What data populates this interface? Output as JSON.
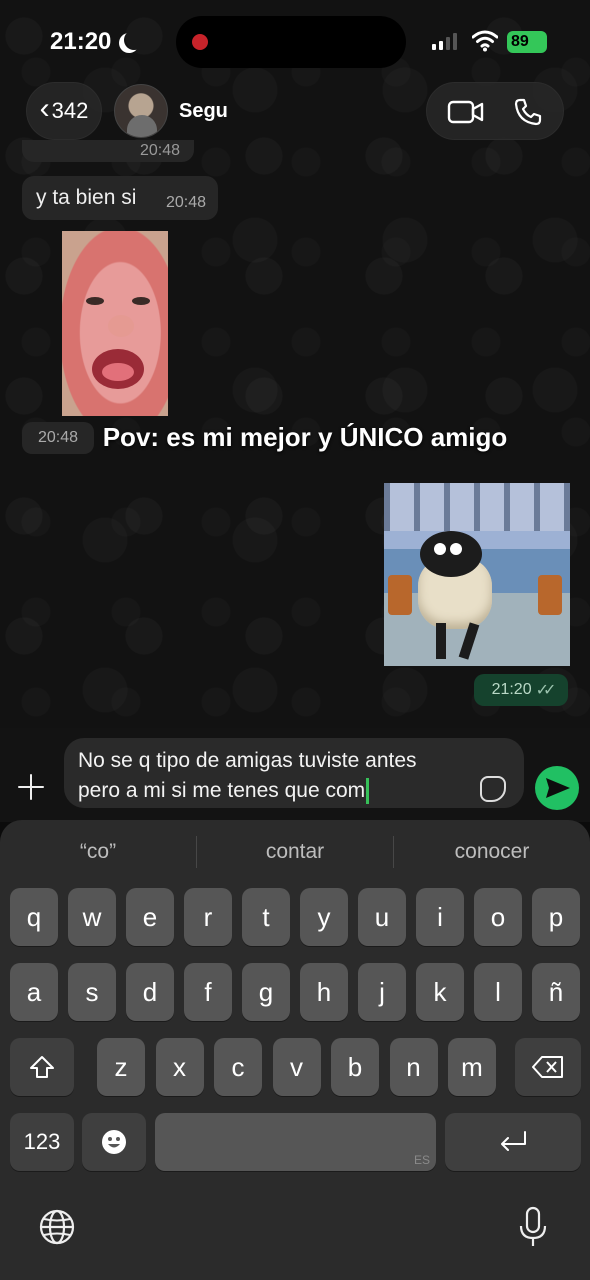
{
  "status_bar": {
    "time": "21:20",
    "battery": "89"
  },
  "header": {
    "back_count": "342",
    "contact_name": "Segu"
  },
  "messages": {
    "partial_time": "20:48",
    "text_message": "y ta bien si",
    "text_time": "20:48",
    "image_time": "20:48",
    "caption": "Pov: es mi mejor y ÚNICO amigo",
    "sent_time": "21:20"
  },
  "compose": {
    "line1": "No se q tipo de amigas tuviste antes",
    "line2": "pero a mi si me tenes que com"
  },
  "keyboard": {
    "suggestions": [
      "“co”",
      "contar",
      "conocer"
    ],
    "row1": [
      "q",
      "w",
      "e",
      "r",
      "t",
      "y",
      "u",
      "i",
      "o",
      "p"
    ],
    "row2": [
      "a",
      "s",
      "d",
      "f",
      "g",
      "h",
      "j",
      "k",
      "l",
      "ñ"
    ],
    "row3": [
      "z",
      "x",
      "c",
      "v",
      "b",
      "n",
      "m"
    ],
    "numbers_key": "123",
    "space_lang": "ES"
  },
  "colors": {
    "accent_green": "#21c063",
    "sent_bubble": "#15422d",
    "keyboard_bg": "#2b2b2b"
  }
}
